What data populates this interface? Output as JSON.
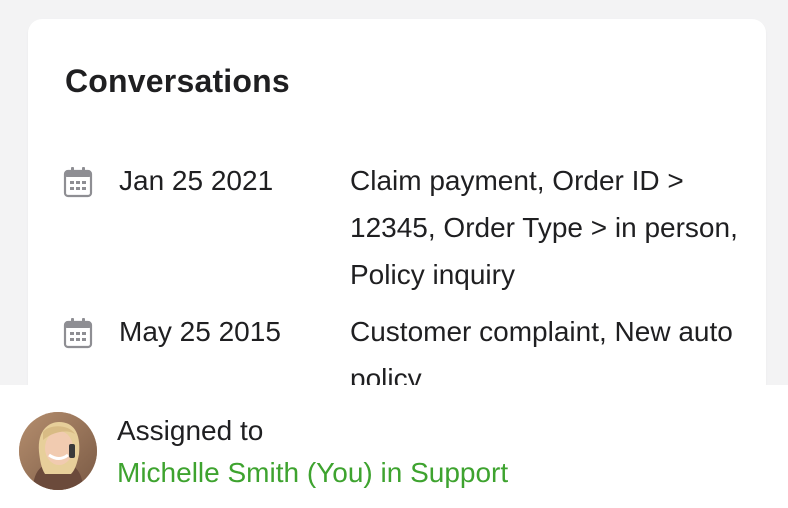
{
  "conversations": {
    "title": "Conversations",
    "items": [
      {
        "icon": "calendar-icon",
        "date": "Jan 25 2021",
        "description": "Claim payment, Order ID > 12345, Order Type > in person, Policy inquiry"
      },
      {
        "icon": "calendar-icon",
        "date": "May 25 2015",
        "description": "Customer complaint, New auto policy"
      }
    ]
  },
  "assignment": {
    "label": "Assigned to",
    "assignee": "Michelle Smith (You) in Support",
    "avatar_icon": "user-avatar",
    "accent_color": "#3ea32f"
  }
}
